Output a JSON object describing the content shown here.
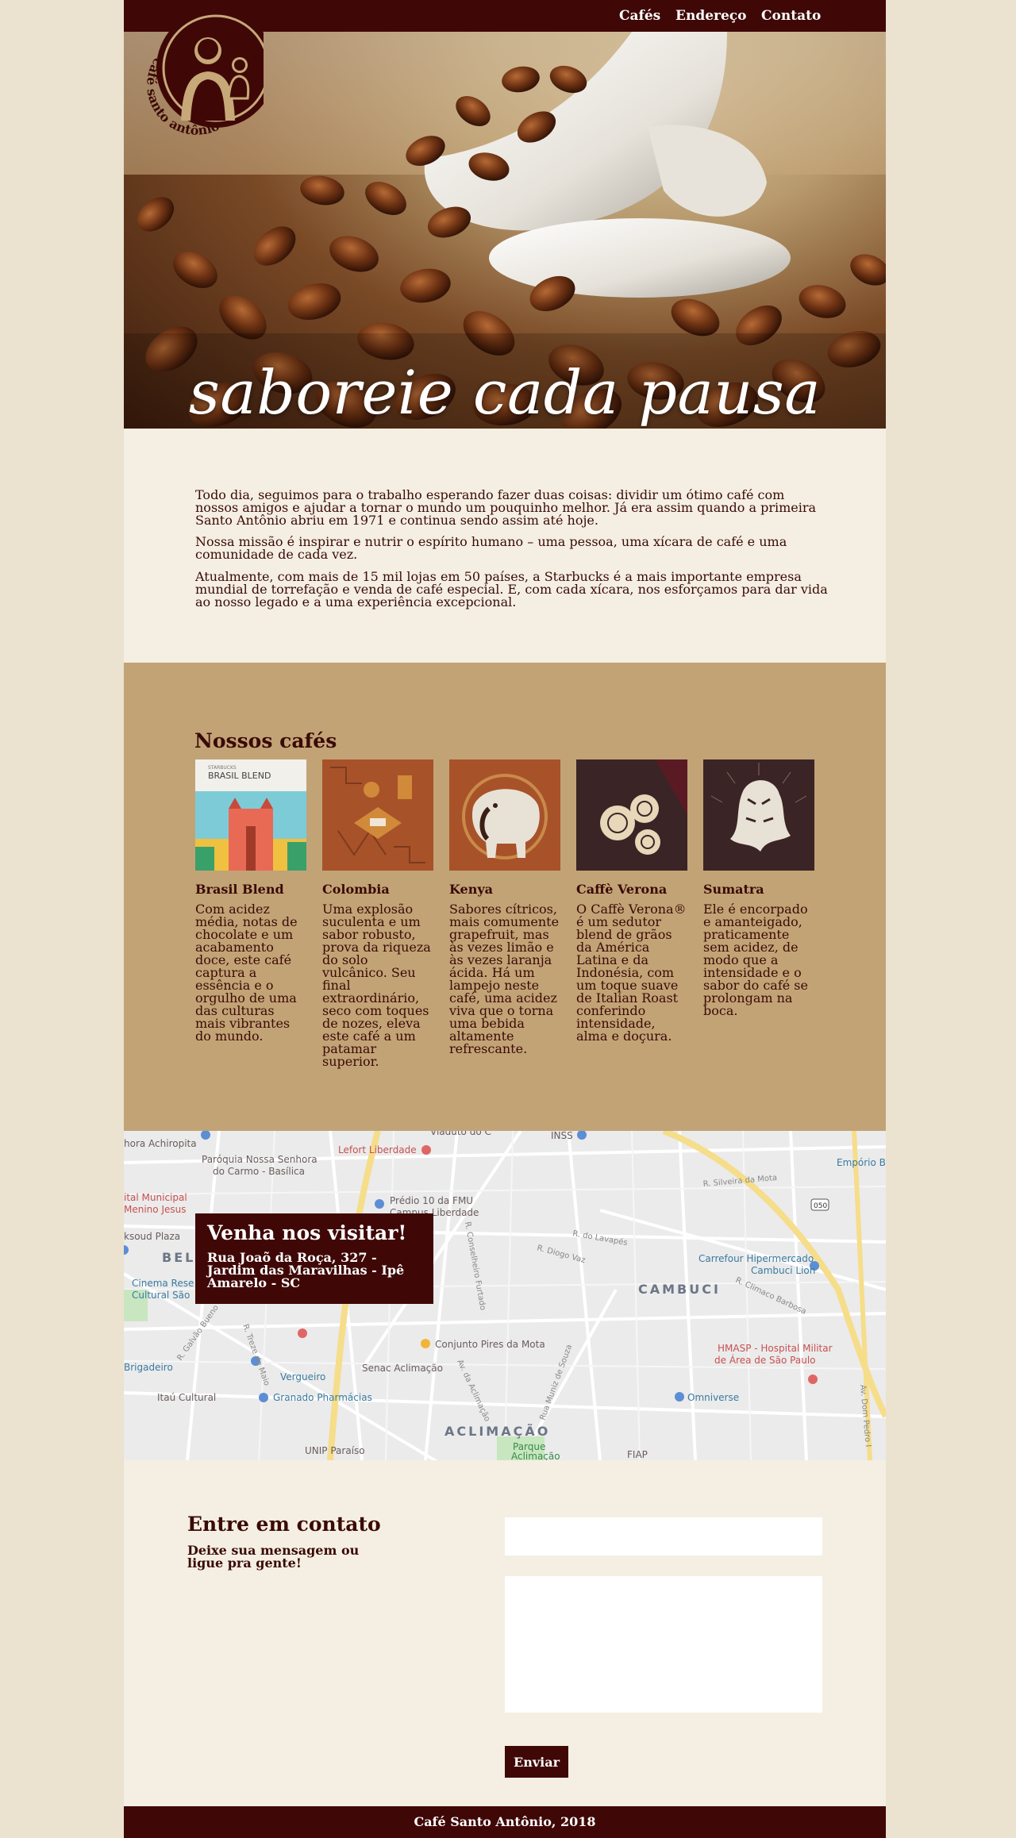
{
  "nav": {
    "items": [
      {
        "label": "Cafés"
      },
      {
        "label": "Endereço"
      },
      {
        "label": "Contato"
      }
    ]
  },
  "logo": {
    "text": "café santo antônio"
  },
  "hero": {
    "title": "saboreie cada pausa"
  },
  "about": {
    "paragraphs": [
      "Todo dia, seguimos para o trabalho esperando fazer duas coisas: dividir um ótimo café com nossos amigos e ajudar a tornar o mundo um pouquinho melhor. Já era assim quando a primeira Santo Antônio abriu em 1971 e continua sendo assim até hoje.",
      "Nossa missão é inspirar e nutrir o espírito humano – uma pessoa, uma xícara de café e uma comunidade de cada vez.",
      "Atualmente, com mais de 15 mil lojas em 50 países, a Starbucks é a mais importante empresa mundial de torrefação e venda de café especial. E, com cada xícara, nos esforçamos para dar vida ao nosso legado e a uma experiência excepcional."
    ]
  },
  "coffees": {
    "title": "Nossos cafés",
    "items": [
      {
        "name": "Brasil Blend",
        "desc": "Com acidez média, notas de chocolate e um acabamento doce, este café captura a essência e o orgulho de uma das culturas mais vibrantes do mundo.",
        "pack_brand": "STARBUCKS",
        "pack_label": "BRASIL BLEND"
      },
      {
        "name": "Colombia",
        "desc": "Uma explosão suculenta e um sabor robusto, prova da riqueza do solo vulcânico. Seu final extraordinário, seco com toques de nozes, eleva este café a um patamar superior."
      },
      {
        "name": "Kenya",
        "desc": "Sabores cítricos, mais comumente grapefruit, mas às vezes limão e às vezes laranja ácida. Há um lampejo neste café, uma acidez viva que o torna uma bebida altamente refrescante."
      },
      {
        "name": "Caffè Verona",
        "desc": "O Caffè Verona® é um sedutor blend de grãos da América Latina e da Indonésia, com um toque suave de Italian Roast conferindo intensidade, alma e doçura."
      },
      {
        "name": "Sumatra",
        "desc": "Ele é encorpado e amanteigado, praticamente sem acidez, de modo que a intensidade e o sabor do café se prolongam na boca."
      }
    ]
  },
  "map": {
    "card_title": "Venha nos visitar!",
    "card_address": "Rua Joaõ da Roça, 327 - Jardim das Maravilhas - Ipê Amarelo - SC",
    "labels": {
      "achiropita": "hora Achiropita",
      "carmo1": "Paróquia Nossa Senhora",
      "carmo2": "do Carmo - Basílica",
      "lefort": "Lefort Liberdade",
      "viaduto": "Viaduto do C",
      "inss": "INSS",
      "emporio": "Empório Be",
      "fmu1": "Prédio 10 da FMU",
      "fmu2": "Campus Liberdade",
      "municipal1": "ital Municipal",
      "municipal2": "Menino Jesus",
      "plaza": "ksoud Plaza",
      "bela": "BEL",
      "cinema1": "Cinema Rese",
      "cinema2": "Cultural São",
      "cambuci": "CAMBUCI",
      "carrefour1": "Carrefour Hipermercado",
      "carrefour2": "Cambuci Lion",
      "conjunto": "Conjunto Pires da Mota",
      "hmasp1": "HMASP - Hospital Militar",
      "hmasp2": "de Área de São Paulo",
      "brigadeiro": "Brigadeiro",
      "vergueiro": "Vergueiro",
      "senac": "Senac Aclimação",
      "granado": "Granado Pharmácias",
      "omniverse": "Omniverse",
      "itau": "Itaú Cultural",
      "aclimacao": "ACLIMAÇÃO",
      "parque1": "Parque",
      "parque2": "Aclimação",
      "unip": "UNIP Paraíso",
      "fiap": "FIAP",
      "shield": "050",
      "r_conselheiro": "R. Conselheiro Furtado",
      "r_climaco": "R. Climaco Barbosa",
      "av_aclimacao": "Av. da Aclimação",
      "r_muniz": "Rua Muniz de Souza",
      "av_dom": "Av. Dom Pedro I",
      "r_treze": "R. Treze de Maio",
      "r_silveira": "R. Silveira da Mota",
      "r_diogo": "R. Diogo Vaz",
      "r_lavapes": "R. do Lavapés",
      "r_galvao": "R. Galvão Bueno"
    }
  },
  "contact": {
    "title": "Entre em contato",
    "subtitle": "Deixe sua mensagem ou ligue pra gente!",
    "name_placeholder": "",
    "message_placeholder": "",
    "submit_label": "Enviar"
  },
  "footer": {
    "text": "Café Santo Antônio, 2018"
  }
}
